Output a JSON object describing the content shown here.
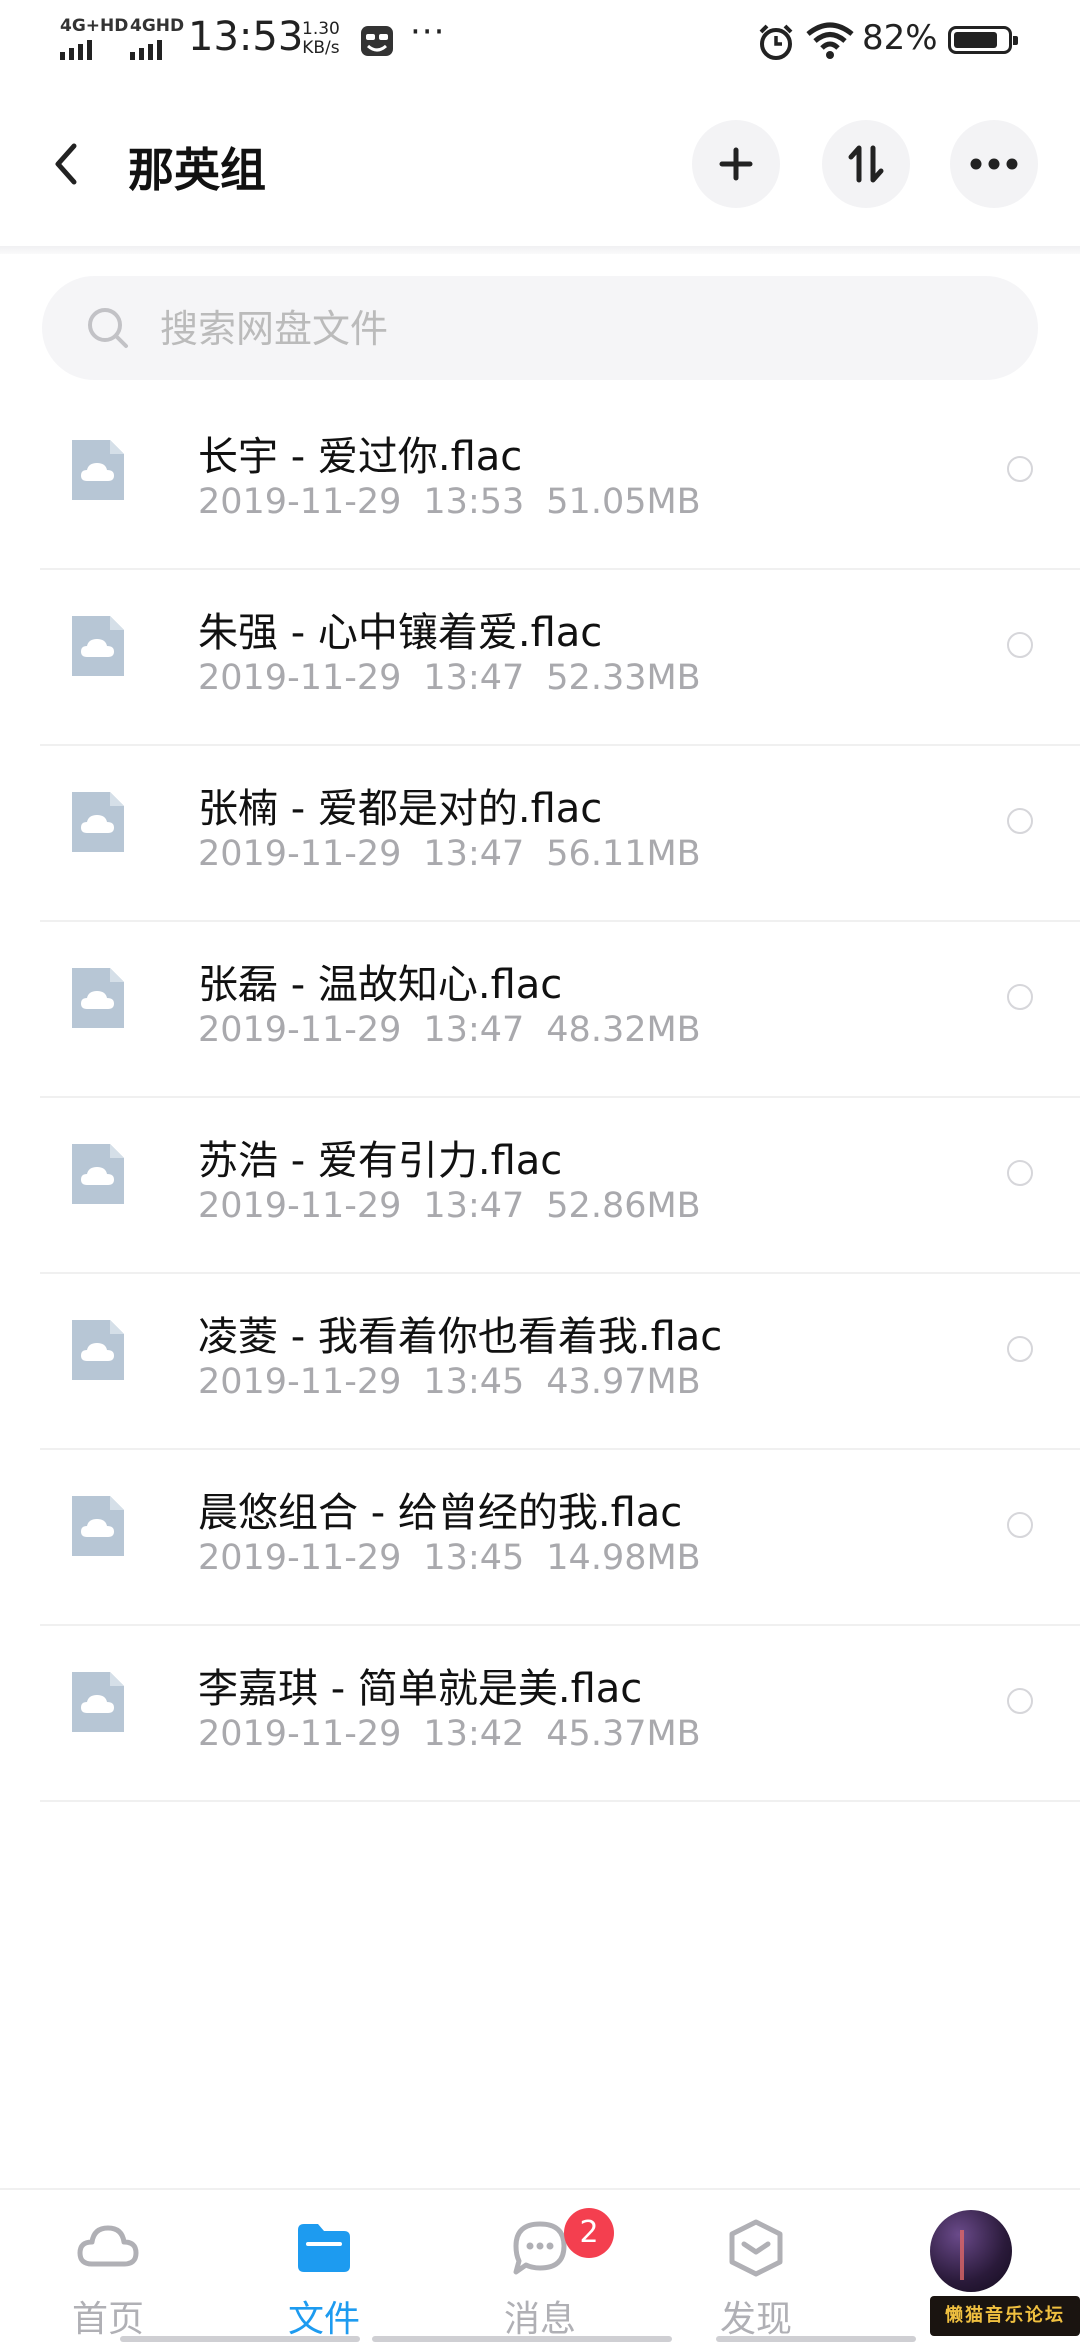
{
  "status_bar": {
    "net1": "4G+HD",
    "net2": "4GHD",
    "time": "13:53",
    "speed_value": "1.30",
    "speed_unit": "KB/s",
    "more": "···",
    "battery_percent": "82%",
    "battery_level": 0.82
  },
  "header": {
    "title": "那英组"
  },
  "search": {
    "placeholder": "搜索网盘文件"
  },
  "files": [
    {
      "name": "长宇 - 爱过你.flac",
      "date": "2019-11-29",
      "time": "13:53",
      "size": "51.05MB"
    },
    {
      "name": "朱强 - 心中镶着爱.flac",
      "date": "2019-11-29",
      "time": "13:47",
      "size": "52.33MB"
    },
    {
      "name": "张楠 - 爱都是对的.flac",
      "date": "2019-11-29",
      "time": "13:47",
      "size": "56.11MB"
    },
    {
      "name": "张磊 - 温故知心.flac",
      "date": "2019-11-29",
      "time": "13:47",
      "size": "48.32MB"
    },
    {
      "name": "苏浩 - 爱有引力.flac",
      "date": "2019-11-29",
      "time": "13:47",
      "size": "52.86MB"
    },
    {
      "name": "凌菱 - 我看着你也看着我.flac",
      "date": "2019-11-29",
      "time": "13:45",
      "size": "43.97MB"
    },
    {
      "name": "晨悠组合 - 给曾经的我.flac",
      "date": "2019-11-29",
      "time": "13:45",
      "size": "14.98MB"
    },
    {
      "name": "李嘉琪 - 简单就是美.flac",
      "date": "2019-11-29",
      "time": "13:42",
      "size": "45.37MB"
    }
  ],
  "bottom_nav": {
    "items": [
      {
        "label": "首页",
        "icon": "cloud-icon",
        "active": false
      },
      {
        "label": "文件",
        "icon": "folder-icon",
        "active": true
      },
      {
        "label": "消息",
        "icon": "chat-icon",
        "active": false,
        "badge": "2"
      },
      {
        "label": "发现",
        "icon": "discover-icon",
        "active": false
      },
      {
        "label": "",
        "icon": "avatar",
        "active": false
      }
    ]
  },
  "watermark": "懒猫音乐论坛",
  "colors": {
    "accent": "#1d9bf0",
    "badge": "#f43f4f",
    "muted_text": "#a9a9ad",
    "file_icon": "#b7c6d5"
  }
}
